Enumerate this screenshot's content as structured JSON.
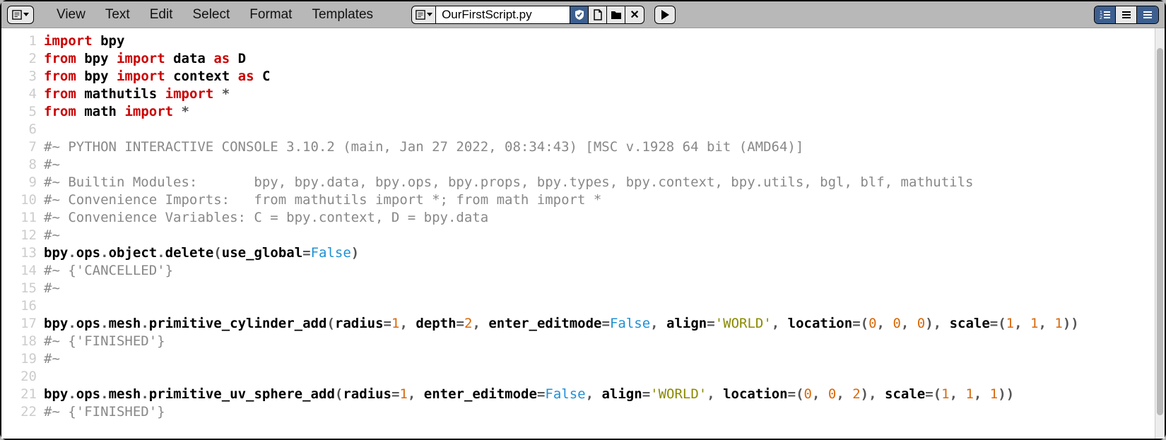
{
  "menu": {
    "items": [
      "View",
      "Text",
      "Edit",
      "Select",
      "Format",
      "Templates"
    ]
  },
  "file": {
    "name": "OurFirstScript.py"
  },
  "code": {
    "lines": [
      [
        [
          "kw",
          "import"
        ],
        [
          "sp",
          " "
        ],
        [
          "name",
          "bpy"
        ]
      ],
      [
        [
          "kw",
          "from"
        ],
        [
          "sp",
          " "
        ],
        [
          "name",
          "bpy"
        ],
        [
          "sp",
          " "
        ],
        [
          "kw",
          "import"
        ],
        [
          "sp",
          " "
        ],
        [
          "name",
          "data"
        ],
        [
          "sp",
          " "
        ],
        [
          "kw",
          "as"
        ],
        [
          "sp",
          " "
        ],
        [
          "name",
          "D"
        ]
      ],
      [
        [
          "kw",
          "from"
        ],
        [
          "sp",
          " "
        ],
        [
          "name",
          "bpy"
        ],
        [
          "sp",
          " "
        ],
        [
          "kw",
          "import"
        ],
        [
          "sp",
          " "
        ],
        [
          "name",
          "context"
        ],
        [
          "sp",
          " "
        ],
        [
          "kw",
          "as"
        ],
        [
          "sp",
          " "
        ],
        [
          "name",
          "C"
        ]
      ],
      [
        [
          "kw",
          "from"
        ],
        [
          "sp",
          " "
        ],
        [
          "name",
          "mathutils"
        ],
        [
          "sp",
          " "
        ],
        [
          "kw",
          "import"
        ],
        [
          "sp",
          " "
        ],
        [
          "op",
          "*"
        ]
      ],
      [
        [
          "kw",
          "from"
        ],
        [
          "sp",
          " "
        ],
        [
          "name",
          "math"
        ],
        [
          "sp",
          " "
        ],
        [
          "kw",
          "import"
        ],
        [
          "sp",
          " "
        ],
        [
          "op",
          "*"
        ]
      ],
      [],
      [
        [
          "cm",
          "#~ PYTHON INTERACTIVE CONSOLE 3.10.2 (main, Jan 27 2022, 08:34:43) [MSC v.1928 64 bit (AMD64)]"
        ]
      ],
      [
        [
          "cm",
          "#~"
        ]
      ],
      [
        [
          "cm",
          "#~ Builtin Modules:       bpy, bpy.data, bpy.ops, bpy.props, bpy.types, bpy.context, bpy.utils, bgl, blf, mathutils"
        ]
      ],
      [
        [
          "cm",
          "#~ Convenience Imports:   from mathutils import *; from math import *"
        ]
      ],
      [
        [
          "cm",
          "#~ Convenience Variables: C = bpy.context, D = bpy.data"
        ]
      ],
      [
        [
          "cm",
          "#~"
        ]
      ],
      [
        [
          "name",
          "bpy"
        ],
        [
          "punc",
          "."
        ],
        [
          "name",
          "ops"
        ],
        [
          "punc",
          "."
        ],
        [
          "name",
          "object"
        ],
        [
          "punc",
          "."
        ],
        [
          "name",
          "delete"
        ],
        [
          "punc",
          "("
        ],
        [
          "name",
          "use_global"
        ],
        [
          "op",
          "="
        ],
        [
          "bool",
          "False"
        ],
        [
          "punc",
          ")"
        ]
      ],
      [
        [
          "cm",
          "#~ {'CANCELLED'}"
        ]
      ],
      [
        [
          "cm",
          "#~"
        ]
      ],
      [],
      [
        [
          "name",
          "bpy"
        ],
        [
          "punc",
          "."
        ],
        [
          "name",
          "ops"
        ],
        [
          "punc",
          "."
        ],
        [
          "name",
          "mesh"
        ],
        [
          "punc",
          "."
        ],
        [
          "name",
          "primitive_cylinder_add"
        ],
        [
          "punc",
          "("
        ],
        [
          "name",
          "radius"
        ],
        [
          "op",
          "="
        ],
        [
          "num",
          "1"
        ],
        [
          "punc",
          ", "
        ],
        [
          "name",
          "depth"
        ],
        [
          "op",
          "="
        ],
        [
          "num",
          "2"
        ],
        [
          "punc",
          ", "
        ],
        [
          "name",
          "enter_editmode"
        ],
        [
          "op",
          "="
        ],
        [
          "bool",
          "False"
        ],
        [
          "punc",
          ", "
        ],
        [
          "name",
          "align"
        ],
        [
          "op",
          "="
        ],
        [
          "str",
          "'WORLD'"
        ],
        [
          "punc",
          ", "
        ],
        [
          "name",
          "location"
        ],
        [
          "op",
          "="
        ],
        [
          "punc",
          "("
        ],
        [
          "num",
          "0"
        ],
        [
          "punc",
          ", "
        ],
        [
          "num",
          "0"
        ],
        [
          "punc",
          ", "
        ],
        [
          "num",
          "0"
        ],
        [
          "punc",
          "), "
        ],
        [
          "name",
          "scale"
        ],
        [
          "op",
          "="
        ],
        [
          "punc",
          "("
        ],
        [
          "num",
          "1"
        ],
        [
          "punc",
          ", "
        ],
        [
          "num",
          "1"
        ],
        [
          "punc",
          ", "
        ],
        [
          "num",
          "1"
        ],
        [
          "punc",
          "))"
        ]
      ],
      [
        [
          "cm",
          "#~ {'FINISHED'}"
        ]
      ],
      [
        [
          "cm",
          "#~"
        ]
      ],
      [],
      [
        [
          "name",
          "bpy"
        ],
        [
          "punc",
          "."
        ],
        [
          "name",
          "ops"
        ],
        [
          "punc",
          "."
        ],
        [
          "name",
          "mesh"
        ],
        [
          "punc",
          "."
        ],
        [
          "name",
          "primitive_uv_sphere_add"
        ],
        [
          "punc",
          "("
        ],
        [
          "name",
          "radius"
        ],
        [
          "op",
          "="
        ],
        [
          "num",
          "1"
        ],
        [
          "punc",
          ", "
        ],
        [
          "name",
          "enter_editmode"
        ],
        [
          "op",
          "="
        ],
        [
          "bool",
          "False"
        ],
        [
          "punc",
          ", "
        ],
        [
          "name",
          "align"
        ],
        [
          "op",
          "="
        ],
        [
          "str",
          "'WORLD'"
        ],
        [
          "punc",
          ", "
        ],
        [
          "name",
          "location"
        ],
        [
          "op",
          "="
        ],
        [
          "punc",
          "("
        ],
        [
          "num",
          "0"
        ],
        [
          "punc",
          ", "
        ],
        [
          "num",
          "0"
        ],
        [
          "punc",
          ", "
        ],
        [
          "num",
          "2"
        ],
        [
          "punc",
          "), "
        ],
        [
          "name",
          "scale"
        ],
        [
          "op",
          "="
        ],
        [
          "punc",
          "("
        ],
        [
          "num",
          "1"
        ],
        [
          "punc",
          ", "
        ],
        [
          "num",
          "1"
        ],
        [
          "punc",
          ", "
        ],
        [
          "num",
          "1"
        ],
        [
          "punc",
          "))"
        ]
      ],
      [
        [
          "cm",
          "#~ {'FINISHED'}"
        ]
      ]
    ]
  }
}
